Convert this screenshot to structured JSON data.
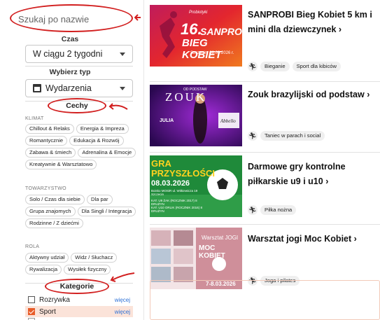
{
  "search": {
    "placeholder": "Szukaj po nazwie"
  },
  "filters": {
    "time_title": "Czas",
    "time_value": "W ciągu 2 tygodni",
    "type_title": "Wybierz typ",
    "type_value": "Wydarzenia",
    "features_title": "Cechy",
    "groups": [
      {
        "label": "KLIMAT",
        "chips": [
          "Chillout & Relaks",
          "Energia & Impreza",
          "Romantycznie",
          "Edukacja & Rozwój",
          "Zabawa & śmiech",
          "Adrenalina & Emocje",
          "Kreatywnie & Warsztatowo"
        ]
      },
      {
        "label": "TOWARZYSTWO",
        "chips": [
          "Solo / Czas dla siebie",
          "Dla par",
          "Grupa znajomych",
          "Dla Singli / Integracja",
          "Rodzinne / Z dziećmi"
        ]
      },
      {
        "label": "ROLA",
        "chips": [
          "Aktywny udział",
          "Widz / Słuchacz",
          "Rywalizacja",
          "Wysiłek fizyczny"
        ]
      }
    ],
    "categories_title": "Kategorie",
    "categories": [
      {
        "label": "Rozrywka",
        "more": "więcej",
        "checked": false
      },
      {
        "label": "Sport",
        "more": "więcej",
        "checked": true
      }
    ]
  },
  "events": [
    {
      "title": "SANPROBI Bieg Kobiet 5 km i mini dla dziewczynek",
      "chevron": "›",
      "tags": [
        "Bieganie",
        "Sport dla kibiców"
      ],
      "thumb": {
        "big": "16.",
        "line1": "SANPROBI",
        "line2": "BIEG KOBIET",
        "small": "Szczecin, 08.03.2026 r.",
        "top": "Probiotyki"
      }
    },
    {
      "title": "Zouk brazylijski od podstaw",
      "chevron": "›",
      "tags": [
        "Taniec w parach i social"
      ],
      "thumb": {
        "top": "OD PODSTAW",
        "main": "ZOUK",
        "name": "JULIA",
        "brand": "Abbello"
      }
    },
    {
      "title": "Darmowe gry kontrolne piłkarskie u9 i u10",
      "chevron": "›",
      "tags": [
        "Piłka nożna"
      ],
      "thumb": {
        "line1": "GRA",
        "line2": "PRZYSZŁOŚCI",
        "date": "08.03.2026",
        "venue": "Boisko MOSiR ul. Witkiewicza 19 Szczecin",
        "kat1": "KAT. U9 ŻAK (ROCZNIK 2017) 8 DRUŻYN",
        "kat2": "KAT. U10 ORLIK (ROCZNIK 2016) 8 DRUŻYN"
      }
    },
    {
      "title": "Warsztat jogi Moc Kobiet",
      "chevron": "›",
      "tags": [
        "Joga i pilates"
      ],
      "thumb": {
        "line1": "Warsztat JOGI",
        "line2": "MOC KOBIET",
        "date": "7-8.03.2026"
      }
    }
  ],
  "colors": {
    "accent": "#e85d2a",
    "annotation": "#d21f1f",
    "link": "#2a6fd6"
  },
  "icons": {
    "calendar": "calendar-icon",
    "sport": "running-person-icon"
  }
}
